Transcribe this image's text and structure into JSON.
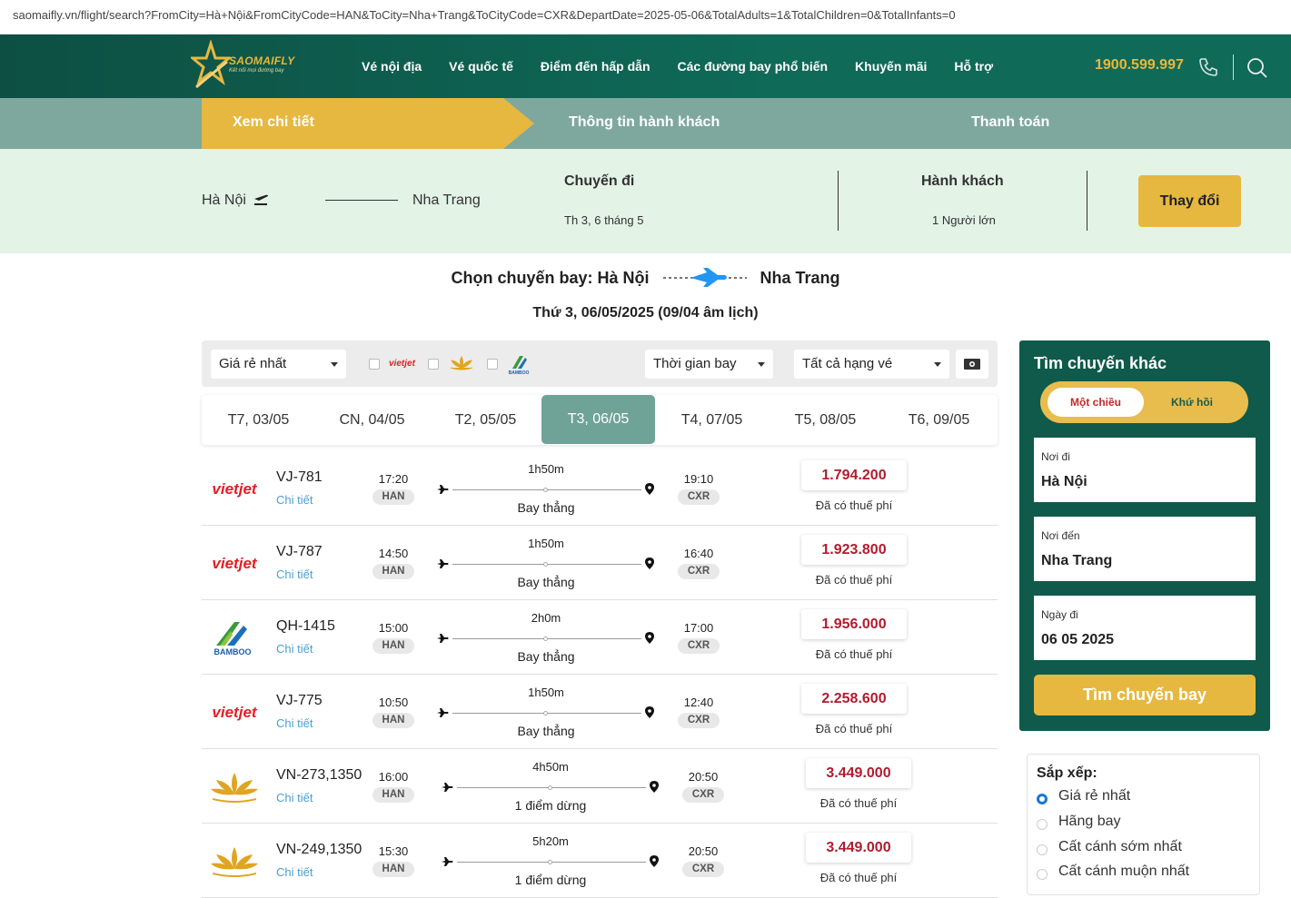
{
  "browser": {
    "url": "saomaifly.vn/flight/search?FromCity=Hà+Nội&FromCityCode=HAN&ToCity=Nha+Trang&ToCityCode=CXR&DepartDate=2025-05-06&TotalAdults=1&TotalChildren=0&TotalInfants=0"
  },
  "header": {
    "logo_text": "SAOMAIFLY",
    "logo_sub": "Kết nối mọi đường bay",
    "nav": [
      "Vé nội địa",
      "Vé quốc tế",
      "Điểm đến hấp dẫn",
      "Các đường bay phổ biến",
      "Khuyến mãi",
      "Hỗ trợ"
    ],
    "hotline": "1900.599.997",
    "brand_color": "#0f6a58",
    "accent_color": "#e6b840"
  },
  "steps": [
    "Xem chi tiết",
    "Thông tin hành khách",
    "Thanh toán"
  ],
  "route": {
    "from": "Hà Nội",
    "to": "Nha Trang",
    "trip_label": "Chuyến đi",
    "trip_date": "Th 3, 6 tháng 5",
    "pax_label": "Hành khách",
    "pax_value": "1 Người lớn",
    "change_button": "Thay đổi"
  },
  "heading": {
    "prefix": "Chọn chuyến bay: Hà Nội",
    "to": "Nha Trang",
    "date": "Thứ 3, 06/05/2025 (09/04 âm lịch)"
  },
  "filters": {
    "sort_select": "Giá rẻ nhất",
    "time_select": "Thời gian bay",
    "class_select": "Tất cả hạng vé",
    "airline_logos": [
      "vietjet",
      "vietnam-airlines",
      "bamboo"
    ]
  },
  "date_tabs": [
    "T7, 03/05",
    "CN, 04/05",
    "T2, 05/05",
    "T3, 06/05",
    "T4, 07/05",
    "T5, 08/05",
    "T6, 09/05"
  ],
  "active_date_index": 3,
  "flights": [
    {
      "airline": "vietjet",
      "code": "VJ-781",
      "detail": "Chi tiết",
      "dep_time": "17:20",
      "dep_ap": "HAN",
      "duration": "1h50m",
      "stop": "Bay thẳng",
      "arr_time": "19:10",
      "arr_ap": "CXR",
      "price": "1.794.200",
      "tax": "Đã có thuế phí"
    },
    {
      "airline": "vietjet",
      "code": "VJ-787",
      "detail": "Chi tiết",
      "dep_time": "14:50",
      "dep_ap": "HAN",
      "duration": "1h50m",
      "stop": "Bay thẳng",
      "arr_time": "16:40",
      "arr_ap": "CXR",
      "price": "1.923.800",
      "tax": "Đã có thuế phí"
    },
    {
      "airline": "bamboo",
      "code": "QH-1415",
      "detail": "Chi tiết",
      "dep_time": "15:00",
      "dep_ap": "HAN",
      "duration": "2h0m",
      "stop": "Bay thẳng",
      "arr_time": "17:00",
      "arr_ap": "CXR",
      "price": "1.956.000",
      "tax": "Đã có thuế phí"
    },
    {
      "airline": "vietjet",
      "code": "VJ-775",
      "detail": "Chi tiết",
      "dep_time": "10:50",
      "dep_ap": "HAN",
      "duration": "1h50m",
      "stop": "Bay thẳng",
      "arr_time": "12:40",
      "arr_ap": "CXR",
      "price": "2.258.600",
      "tax": "Đã có thuế phí"
    },
    {
      "airline": "vietnam-airlines",
      "code": "VN-273,1350",
      "detail": "Chi tiết",
      "dep_time": "16:00",
      "dep_ap": "HAN",
      "duration": "4h50m",
      "stop": "1 điểm dừng",
      "arr_time": "20:50",
      "arr_ap": "CXR",
      "price": "3.449.000",
      "tax": "Đã có thuế phí"
    },
    {
      "airline": "vietnam-airlines",
      "code": "VN-249,1350",
      "detail": "Chi tiết",
      "dep_time": "15:30",
      "dep_ap": "HAN",
      "duration": "5h20m",
      "stop": "1 điểm dừng",
      "arr_time": "20:50",
      "arr_ap": "CXR",
      "price": "3.449.000",
      "tax": "Đã có thuế phí"
    }
  ],
  "search_box": {
    "title": "Tìm chuyến khác",
    "one_way": "Một chiều",
    "round_trip": "Khứ hồi",
    "from_label": "Nơi đi",
    "from_value": "Hà Nội",
    "to_label": "Nơi đến",
    "to_value": "Nha Trang",
    "date_label": "Ngày đi",
    "date_value": "06 05 2025",
    "button": "Tìm chuyến bay"
  },
  "sort": {
    "title": "Sắp xếp:",
    "options": [
      "Giá rẻ nhất",
      "Hãng bay",
      "Cất cánh sớm nhất",
      "Cất cánh muộn nhất"
    ],
    "selected_index": 0
  }
}
